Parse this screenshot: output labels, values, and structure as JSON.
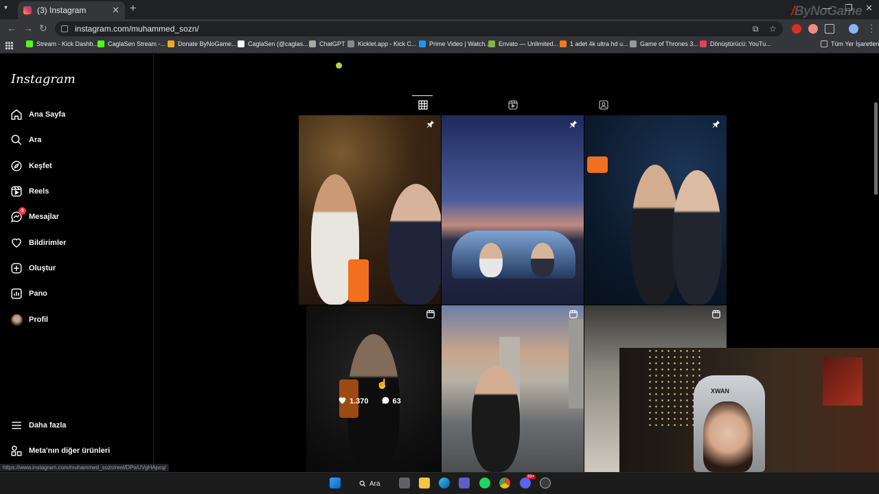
{
  "browser": {
    "tab_title": "(3) Instagram",
    "url": "instagram.com/muhammed_sozn/",
    "brand_watermark": "ByNoGame",
    "bookmarks": [
      {
        "label": "Stream - Kick Dashb...",
        "color": "#53fc18"
      },
      {
        "label": "CaglaSen Stream -...",
        "color": "#53fc18"
      },
      {
        "label": "Donate ByNoGame...",
        "color": "#f5a623"
      },
      {
        "label": "CaglaSen (@caglas...",
        "color": "#ffffff"
      },
      {
        "label": "ChatGPT",
        "color": "#aaaaaa"
      },
      {
        "label": "Kicklet.app - Kick C...",
        "color": "#888888"
      },
      {
        "label": "Prime Video | Watch...",
        "color": "#1a98ff"
      },
      {
        "label": "Envato — Unlimited...",
        "color": "#82b541"
      },
      {
        "label": "1 adet 4k ultra hd u...",
        "color": "#f27a1a"
      },
      {
        "label": "Game of Thrones 3...",
        "color": "#999999"
      },
      {
        "label": "Dönüştürücü: YouTu...",
        "color": "#e4405f"
      }
    ],
    "all_bookmarks": "Tüm Yer İşaretleri",
    "status_url": "https://www.instagram.com/muhammed_sozn/reel/DPwUVgHApcq/"
  },
  "sidebar": {
    "logo": "Instagram",
    "items": [
      {
        "label": "Ana Sayfa",
        "icon": "home-icon"
      },
      {
        "label": "Ara",
        "icon": "search-icon"
      },
      {
        "label": "Keşfet",
        "icon": "compass-icon"
      },
      {
        "label": "Reels",
        "icon": "reels-icon"
      },
      {
        "label": "Mesajlar",
        "icon": "messenger-icon",
        "badge": "3"
      },
      {
        "label": "Bildirimler",
        "icon": "heart-icon"
      },
      {
        "label": "Oluştur",
        "icon": "plus-square-icon"
      },
      {
        "label": "Pano",
        "icon": "dashboard-icon"
      },
      {
        "label": "Profil",
        "icon": "avatar"
      }
    ],
    "more": "Daha fazla",
    "meta": "Meta'nın diğer ürünleri"
  },
  "profile_tabs": [
    "posts-grid",
    "reels",
    "tagged"
  ],
  "posts": [
    {
      "kind": "pinned"
    },
    {
      "kind": "pinned"
    },
    {
      "kind": "pinned"
    },
    {
      "kind": "reel",
      "likes": "1.370",
      "comments": "63",
      "hovered": true
    },
    {
      "kind": "reel"
    },
    {
      "kind": "reel"
    }
  ],
  "taskbar": {
    "search_label": "Ara",
    "chrome_badge": "99+"
  },
  "webcam": {
    "chair_label": "XWAN"
  }
}
